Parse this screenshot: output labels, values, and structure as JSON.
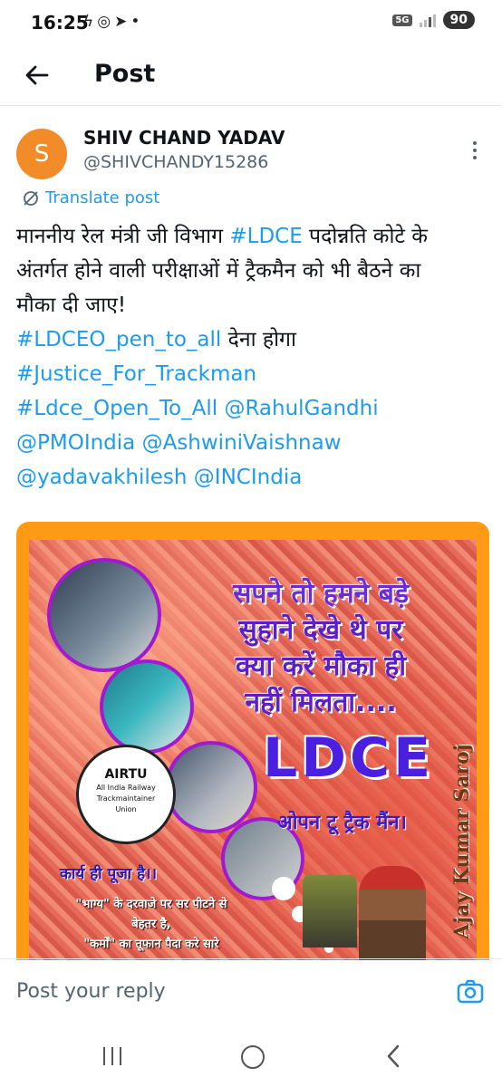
{
  "status_bar": {
    "time": "16:25",
    "icons": [
      "bolt-icon",
      "whatsapp-icon",
      "telegram-icon",
      "dot-icon"
    ],
    "network": "5G",
    "battery": "90"
  },
  "header": {
    "title": "Post"
  },
  "post": {
    "avatar_letter": "S",
    "avatar_color": "#f28c28",
    "author_name": "SHIV CHAND YADAV",
    "author_handle": "@SHIVCHANDY15286",
    "translate_label": "Translate post",
    "body": {
      "l1_a": "माननीय रेल मंत्री जी विभाग ",
      "l1_tag": "#LDCE",
      "l1_b": " पदोन्नति कोटे के",
      "l2": "अंतर्गत होने वाली परीक्षाओं में ट्रैकमैन को भी बैठने का",
      "l3": "मौका दी जाए!",
      "l4_tag": "#LDCEO_pen_to_all",
      "l4_b": " देना होगा",
      "l5_tag": "#Justice_For_Trackman",
      "l6_tag1": "#Ldce_Open_To_All",
      "l6_tag2": " @RahulGandhi",
      "l7_tag1": "@PMOIndia",
      "l7_tag2": " @AshwiniVaishnaw",
      "l8_tag1": "@yadavakhilesh",
      "l8_tag2": " @INCIndia"
    },
    "link_color": "#1d9bf0",
    "image": {
      "headline_1": "सपने तो हमने बड़े",
      "headline_2": "सुहाने देखे थे पर",
      "headline_3": "क्या करें मौका ही",
      "headline_4": "नहीं मिलता....",
      "big_text": "LDCE",
      "subtext": "ओपन टू ट्रैक मैंन।",
      "vertical_name": "Ajay Kumar Saroj",
      "logo_title": "AIRTU",
      "logo_sub_1": "All India Railway",
      "logo_sub_2": "Trackmaintainer",
      "logo_sub_3": "Union",
      "slogan": "कार्य ही पूजा है।।",
      "quote_1": "\"भाग्य\" के दरवाजे पर सर पीटने से",
      "quote_2": "बेहतर है,",
      "quote_3": "\"कर्मों\" का तूफान पैदा करे सारे"
    }
  },
  "reply": {
    "placeholder": "Post your reply"
  },
  "nav": {
    "icons": [
      "recent-apps-icon",
      "home-icon",
      "back-icon"
    ]
  }
}
